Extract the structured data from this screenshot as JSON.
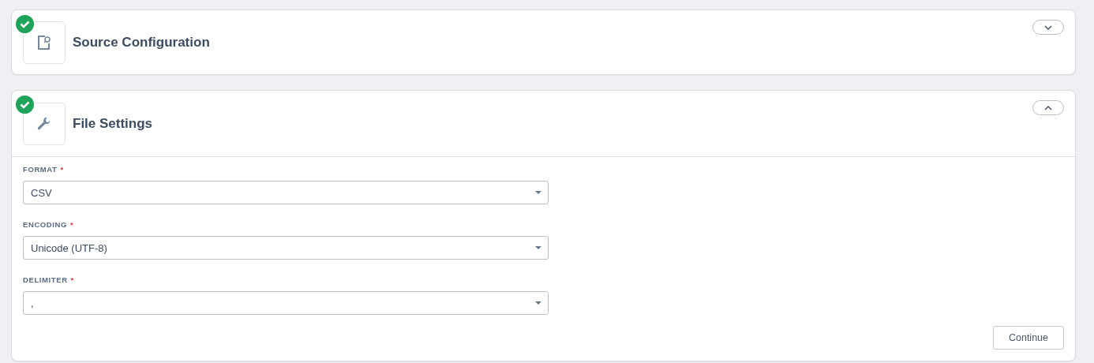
{
  "sections": [
    {
      "title": "Source Configuration",
      "kind": "document",
      "completed": true,
      "expanded": false
    },
    {
      "title": "File Settings",
      "kind": "wrench",
      "completed": true,
      "expanded": true,
      "fields": [
        {
          "label": "FORMAT",
          "required_mark": "*",
          "value": "CSV"
        },
        {
          "label": "ENCODING",
          "required_mark": "*",
          "value": "Unicode (UTF-8)"
        },
        {
          "label": "DELIMITER",
          "required_mark": "*",
          "value": ","
        }
      ],
      "button": "Continue"
    }
  ]
}
